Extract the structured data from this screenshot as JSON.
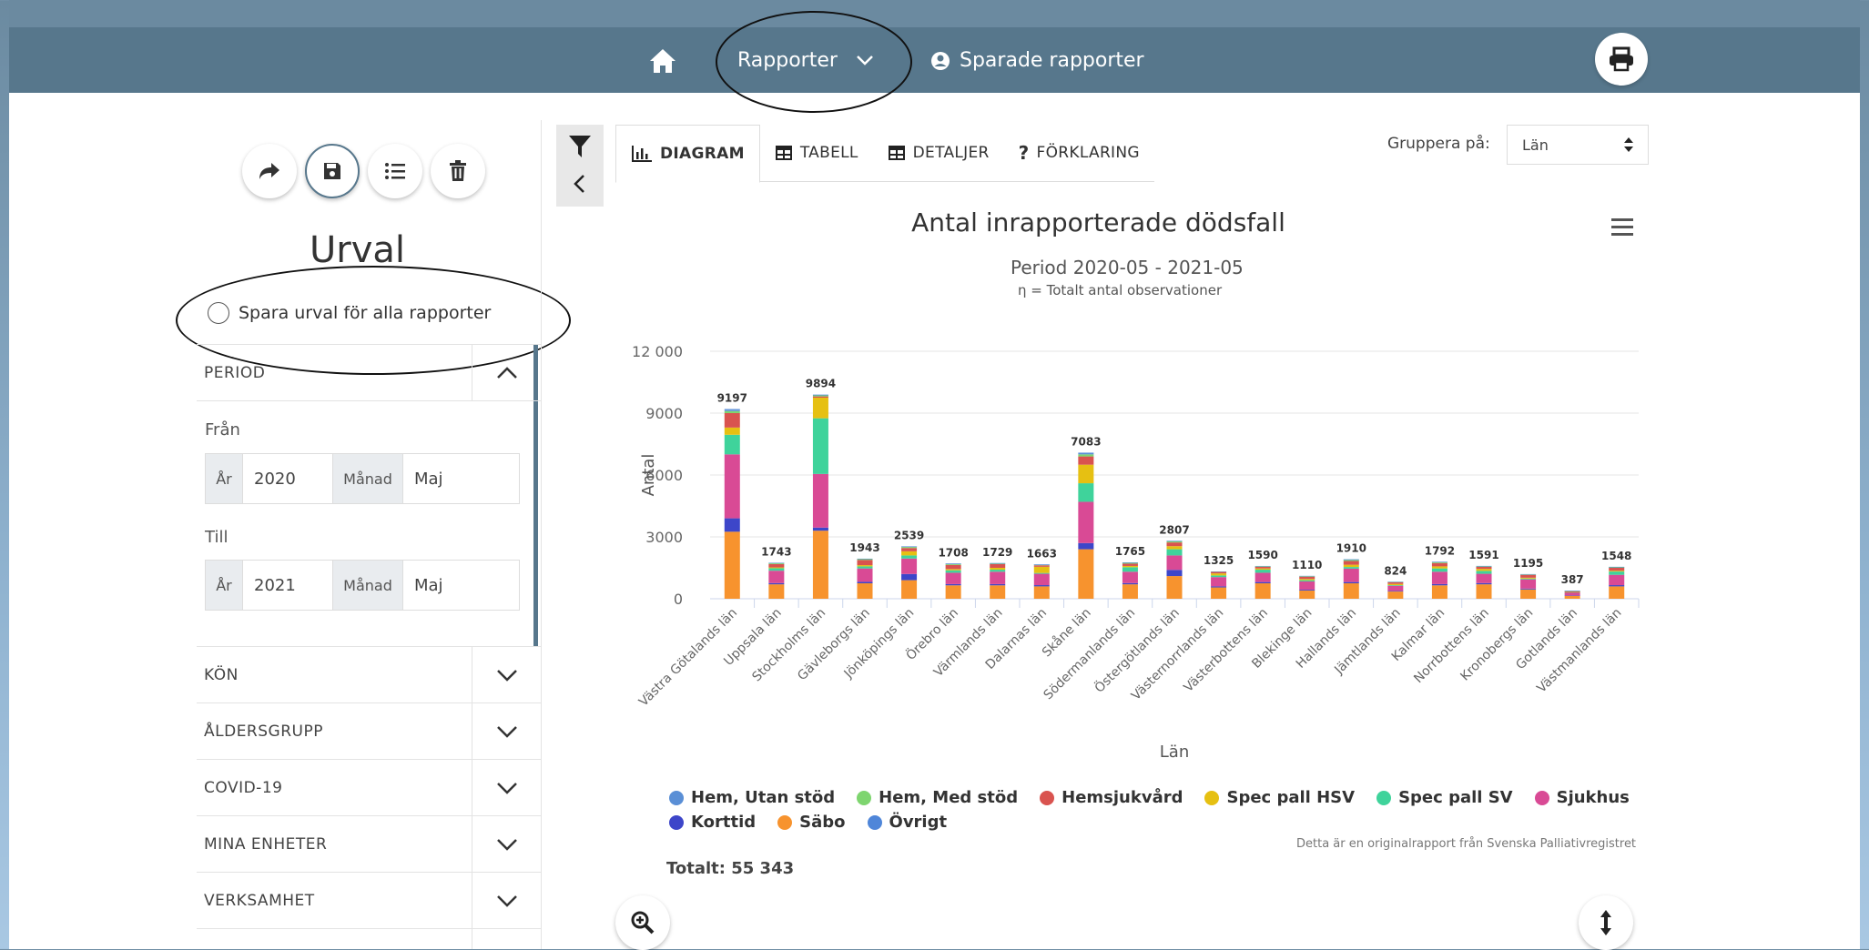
{
  "nav": {
    "rapporter": "Rapporter",
    "sparade": "Sparade rapporter"
  },
  "left": {
    "title": "Urval",
    "spara": "Spara urval för alla rapporter",
    "period_label": "PERIOD",
    "fran_label": "Från",
    "till_label": "Till",
    "ar_label": "År",
    "manad_label": "Månad",
    "fran_ar": "2020",
    "fran_manad": "Maj",
    "till_ar": "2021",
    "till_manad": "Maj",
    "sections": [
      "KÖN",
      "ÅLDERSGRUPP",
      "COVID-19",
      "MINA ENHETER",
      "VERKSAMHET"
    ]
  },
  "tabs": [
    "DIAGRAM",
    "TABELL",
    "DETALJER",
    "FÖRKLARING"
  ],
  "gruppera": {
    "label": "Gruppera på:",
    "value": "Län"
  },
  "chart": {
    "subtitle": "Period 2020-05 - 2021-05",
    "note": "η = Totalt antal observationer",
    "credit": "Detta är en originalrapport från Svenska Palliativregistret",
    "total": "Totalt: 55 343"
  },
  "colors": {
    "Hem, Utan stöd": "#5a8fd6",
    "Hem, Med stöd": "#7ed56f",
    "Hemsjukvård": "#d9534f",
    "Spec pall HSV": "#e6c012",
    "Spec pall SV": "#3fd39b",
    "Sjukhus": "#d94a95",
    "Korttid": "#3d46c9",
    "Säbo": "#f7932e",
    "Övrigt": "#4f86d9"
  },
  "chart_data": {
    "type": "bar",
    "title": "Antal inrapporterade dödsfall",
    "xlabel": "Län",
    "ylabel": "Antal",
    "ylim": [
      0,
      12000
    ],
    "yticks": [
      0,
      3000,
      6000,
      9000,
      12000
    ],
    "ytick_labels": [
      "0",
      "3000",
      "6000",
      "9000",
      "12 000"
    ],
    "stacked": true,
    "categories": [
      "Västra Götalands län",
      "Uppsala län",
      "Stockholms län",
      "Gävleborgs län",
      "Jönköpings län",
      "Örebro län",
      "Värmlands län",
      "Dalarnas län",
      "Skåne län",
      "Södermanlands län",
      "Östergötlands län",
      "Västernorrlands län",
      "Västerbottens län",
      "Blekinge län",
      "Hallands län",
      "Jämtlands län",
      "Kalmar län",
      "Norrbottens län",
      "Kronobergs län",
      "Gotlands län",
      "Västmanlands län"
    ],
    "totals": [
      9197,
      1743,
      9894,
      1943,
      2539,
      1708,
      1729,
      1663,
      7083,
      1765,
      2807,
      1325,
      1590,
      1110,
      1910,
      824,
      1792,
      1591,
      1195,
      387,
      1548
    ],
    "series": [
      {
        "name": "Säbo",
        "values": [
          3250,
          700,
          3300,
          750,
          900,
          650,
          650,
          600,
          2400,
          700,
          1100,
          550,
          750,
          400,
          750,
          350,
          650,
          700,
          450,
          150,
          600
        ]
      },
      {
        "name": "Korttid",
        "values": [
          650,
          60,
          150,
          70,
          300,
          60,
          60,
          60,
          300,
          60,
          300,
          50,
          60,
          40,
          60,
          30,
          60,
          60,
          40,
          10,
          60
        ]
      },
      {
        "name": "Sjukhus",
        "values": [
          3100,
          600,
          2600,
          650,
          750,
          550,
          600,
          550,
          2000,
          550,
          700,
          450,
          450,
          400,
          650,
          250,
          600,
          450,
          450,
          150,
          500
        ]
      },
      {
        "name": "Spec pall SV",
        "values": [
          950,
          120,
          2700,
          100,
          150,
          120,
          100,
          40,
          900,
          220,
          300,
          80,
          150,
          60,
          80,
          30,
          160,
          140,
          40,
          10,
          160
        ]
      },
      {
        "name": "Spec pall HSV",
        "values": [
          350,
          40,
          1000,
          60,
          200,
          60,
          90,
          300,
          900,
          60,
          150,
          100,
          60,
          60,
          110,
          60,
          100,
          100,
          40,
          10,
          40
        ]
      },
      {
        "name": "Hemsjukvård",
        "values": [
          700,
          160,
          60,
          250,
          160,
          200,
          180,
          70,
          400,
          110,
          180,
          70,
          80,
          110,
          180,
          80,
          160,
          100,
          140,
          40,
          140
        ]
      },
      {
        "name": "Hem, Med stöd",
        "values": [
          100,
          40,
          50,
          40,
          50,
          40,
          30,
          30,
          100,
          40,
          50,
          20,
          30,
          30,
          50,
          20,
          40,
          30,
          20,
          10,
          30
        ]
      },
      {
        "name": "Hem, Utan stöd",
        "values": [
          70,
          20,
          30,
          20,
          25,
          25,
          15,
          10,
          60,
          20,
          25,
          5,
          10,
          10,
          25,
          4,
          20,
          10,
          15,
          5,
          15
        ]
      },
      {
        "name": "Övrigt",
        "values": [
          27,
          3,
          4,
          3,
          4,
          3,
          4,
          3,
          23,
          5,
          2,
          0,
          0,
          0,
          5,
          0,
          2,
          1,
          0,
          2,
          3
        ]
      }
    ],
    "legend_order": [
      "Hem, Utan stöd",
      "Hem, Med stöd",
      "Hemsjukvård",
      "Spec pall HSV",
      "Spec pall SV",
      "Sjukhus",
      "Korttid",
      "Säbo",
      "Övrigt"
    ],
    "grid": true,
    "legend_position": "bottom"
  }
}
